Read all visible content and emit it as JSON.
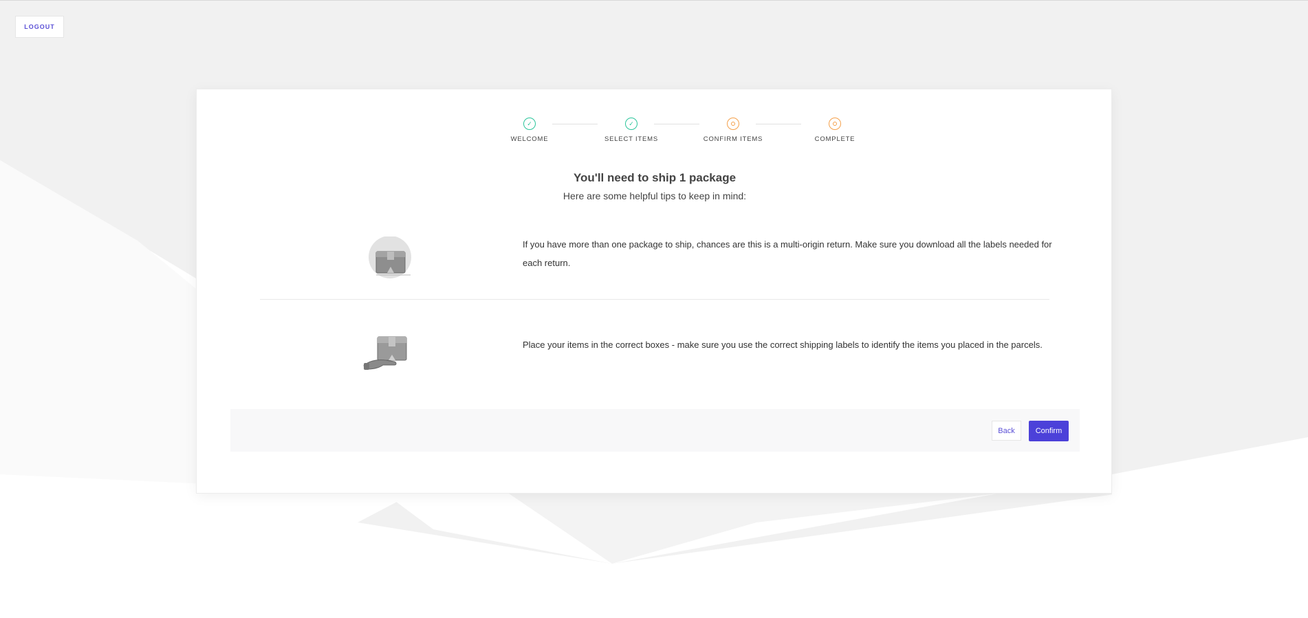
{
  "header": {
    "logout_label": "LOGOUT"
  },
  "stepper": {
    "steps": [
      {
        "label": "WELCOME",
        "status": "done"
      },
      {
        "label": "SELECT ITEMS",
        "status": "done"
      },
      {
        "label": "CONFIRM ITEMS",
        "status": "pending"
      },
      {
        "label": "COMPLETE",
        "status": "pending"
      }
    ]
  },
  "main": {
    "title": "You'll need to ship 1 package",
    "subtitle": "Here are some helpful tips to keep in mind:",
    "tips": [
      {
        "icon": "package-icon",
        "text": "If you have more than one package to ship, chances are this is a multi-origin return. Make sure you download all the labels needed for each return."
      },
      {
        "icon": "hand-package-icon",
        "text": "Place your items in the correct boxes - make sure you use the correct shipping labels to identify the items you placed in the parcels."
      }
    ]
  },
  "footer": {
    "back_label": "Back",
    "confirm_label": "Confirm"
  },
  "colors": {
    "accent": "#4c41d9",
    "done": "#2bc59b",
    "pending": "#f5a04a"
  }
}
